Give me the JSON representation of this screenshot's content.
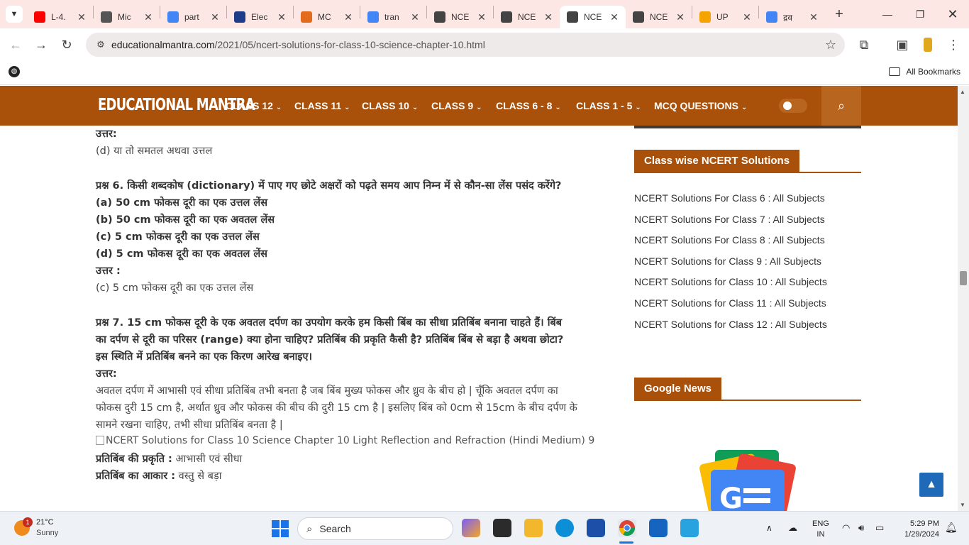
{
  "browser": {
    "tabs": [
      {
        "title": "L-4.",
        "icon": "youtube-icon",
        "color": "#ff0000"
      },
      {
        "title": "Mic",
        "icon": "globe-icon",
        "color": "#555555"
      },
      {
        "title": "part",
        "icon": "google-icon",
        "color": "#4285f4"
      },
      {
        "title": "Elec",
        "icon": "tally-icon",
        "color": "#1f3c88"
      },
      {
        "title": "MC",
        "icon": "fox-icon",
        "color": "#e36b1c"
      },
      {
        "title": "tran",
        "icon": "google-icon",
        "color": "#4285f4"
      },
      {
        "title": "NCE",
        "icon": "site-icon",
        "color": "#444444"
      },
      {
        "title": "NCE",
        "icon": "site-icon",
        "color": "#444444"
      },
      {
        "title": "NCE",
        "icon": "site-icon",
        "color": "#444444",
        "active": true
      },
      {
        "title": "NCE",
        "icon": "site-icon",
        "color": "#444444"
      },
      {
        "title": "UP",
        "icon": "rainbow-icon",
        "color": "#f4a300"
      },
      {
        "title": "द्रव",
        "icon": "google-icon",
        "color": "#4285f4"
      }
    ],
    "url_host": "educationalmantra.com",
    "url_path": "/2021/05/ncert-solutions-for-class-10-science-chapter-10.html",
    "all_bookmarks": "All Bookmarks"
  },
  "site": {
    "logo": "EDUCATIONAL MANTRA",
    "nav": [
      "CLASS 12",
      "CLASS 11",
      "CLASS 10",
      "CLASS 9",
      "CLASS 6 - 8",
      "CLASS 1 - 5",
      "MCQ QUESTIONS"
    ],
    "accent": "#a9510a"
  },
  "article": {
    "l1": "उत्तर:",
    "l2": "(d) या तो समतल अथवा उत्तल",
    "q6": "प्रश्न 6. किसी शब्दकोष (dictionary) में पाए गए छोटे अक्षरों को पढ़ते समय आप निम्न में से कौन-सा लेंस पसंद करेंगे?",
    "q6a": "(a) 50 cm फोकस दूरी का एक उत्तल लेंस",
    "q6b": "(b) 50 cm फोकस दूरी का एक अवतल लेंस",
    "q6c": "(c) 5 cm फोकस दूरी का एक उत्तल लेंस",
    "q6d": "(d) 5 cm फोकस दूरी का एक अवतल लेंस",
    "ans6_label": "उत्तर :",
    "ans6": "(c) 5 cm फोकस दूरी का एक उत्तल लेंस",
    "q7_1": "प्रश्न 7. 15 cm फोकस दूरी के एक अवतल दर्पण का उपयोग करके हम किसी बिंब का सीधा प्रतिबिंब बनाना चाहते हैं। बिंब",
    "q7_2": "का दर्पण से दूरी का परिसर (range) क्या होना चाहिए? प्रतिबिंब की प्रकृति कैसी है? प्रतिबिंब बिंब से बड़ा है अथवा छोटा?",
    "q7_3": "इस स्थिति में प्रतिबिंब बनने का एक किरण आरेख बनाइए।",
    "ans7_label": "उत्तर:",
    "ans7_1": "अवतल दर्पण में आभासी एवं सीधा प्रतिबिंब तभी बनता है जब बिंब मुख्य फोकस और ध्रुव के बीच हो | चूँकि अवतल दर्पण का",
    "ans7_2": "फोकस दुरी 15 cm है, अर्थात ध्रुव और फोकस की बीच की दुरी 15 cm है | इसलिए बिंब को 0cm से 15cm के बीच दर्पण के",
    "ans7_3": "सामने रखना चाहिए, तभी सीधा प्रतिबिंब बनता है |",
    "img_alt": "NCERT Solutions for Class 10 Science Chapter 10 Light Reflection and Refraction (Hindi Medium) 9",
    "nature_label": "प्रतिबिंब की प्रकृति :",
    "nature_value": "आभासी एवं सीधा",
    "size_label": "प्रतिबिंब का आकार :",
    "size_value": "वस्तु से बड़ा"
  },
  "sidebar": {
    "heading1": "Class wise NCERT Solutions",
    "links": [
      "NCERT Solutions For Class 6 : All Subjects",
      "NCERT Solutions For Class 7 : All Subjects",
      "NCERT Solutions For Class 8 : All Subjects",
      "NCERT Solutions for Class 9 : All Subjects",
      "NCERT Solutions for Class 10 : All Subjects",
      "NCERT Solutions for Class 11 : All Subjects",
      "NCERT Solutions for Class 12 : All Subjects"
    ],
    "heading2": "Google News"
  },
  "taskbar": {
    "weather_badge": "1",
    "temp": "21°C",
    "condition": "Sunny",
    "search_placeholder": "Search",
    "lang1": "ENG",
    "lang2": "IN",
    "time": "5:29 PM",
    "date": "1/29/2024"
  }
}
